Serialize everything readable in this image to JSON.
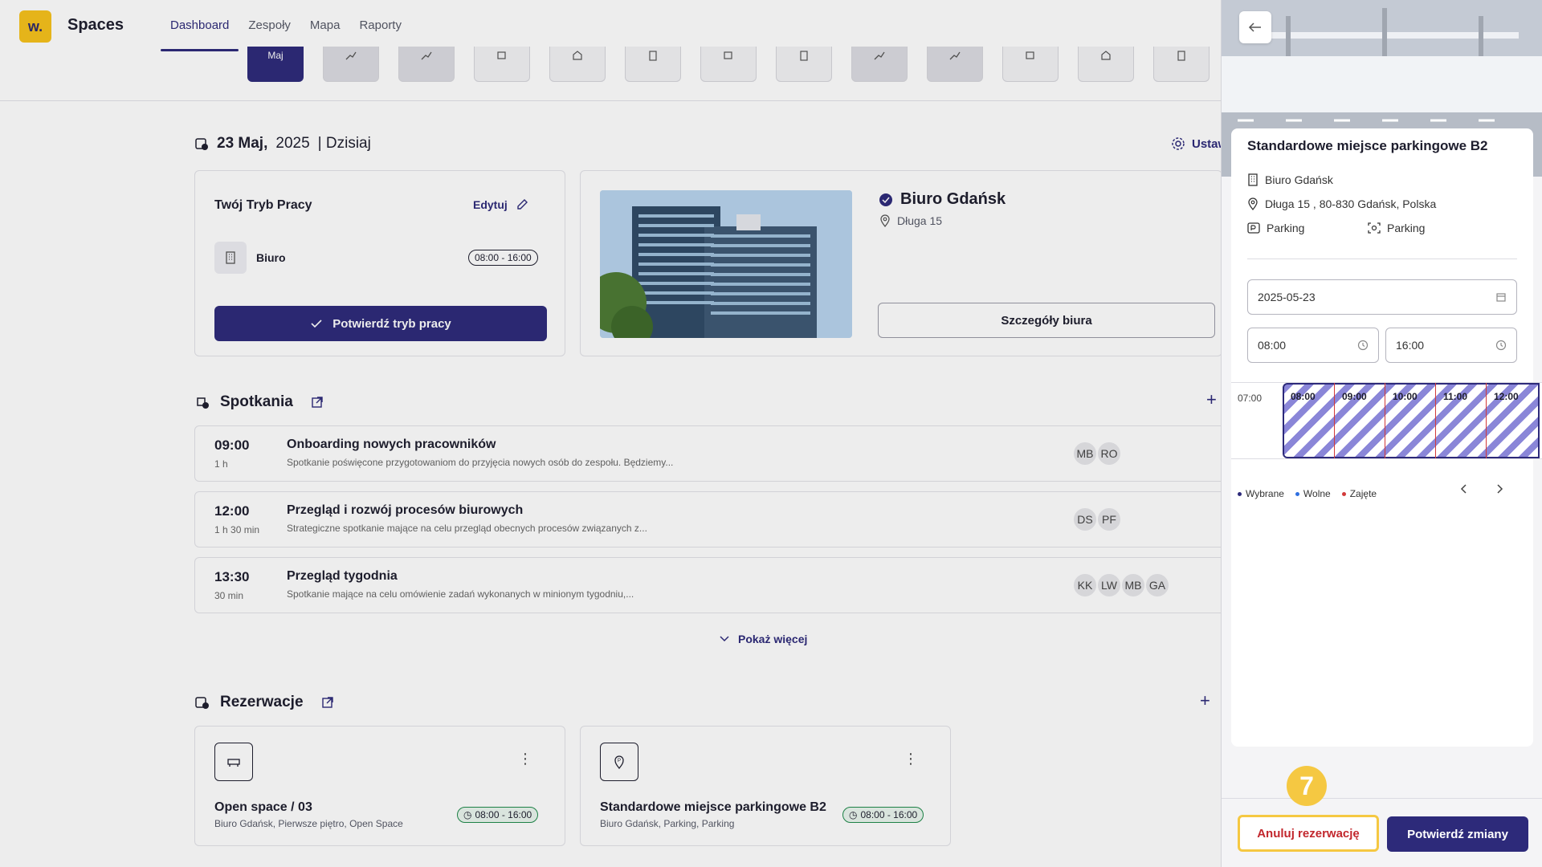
{
  "app": {
    "logo_text": "w.",
    "title": "Spaces"
  },
  "nav": {
    "items": [
      "Dashboard",
      "Zespoły",
      "Mapa",
      "Raporty"
    ],
    "active": "Dashboard"
  },
  "day_strip": {
    "selected_label": "Maj"
  },
  "date_header": {
    "day": "23 Maj,",
    "year": "2025",
    "today": "| Dzisiaj",
    "settings": "Ustaw"
  },
  "work_mode": {
    "title": "Twój Tryb Pracy",
    "edit": "Edytuj",
    "mode": "Biuro",
    "time": "08:00 - 16:00",
    "confirm": "Potwierdź tryb pracy"
  },
  "office": {
    "name": "Biuro Gdańsk",
    "address": "Długa 15",
    "details_button": "Szczegóły biura"
  },
  "meetings": {
    "title": "Spotkania",
    "show_more": "Pokaż więcej",
    "items": [
      {
        "time": "09:00",
        "duration": "1 h",
        "title": "Onboarding nowych pracowników",
        "desc": "Spotkanie poświęcone przygotowaniom do przyjęcia nowych osób do zespołu. Będziemy...",
        "avatars": [
          "MB",
          "RO"
        ]
      },
      {
        "time": "12:00",
        "duration": "1 h 30 min",
        "title": "Przegląd i rozwój procesów biurowych",
        "desc": "Strategiczne spotkanie mające na celu przegląd obecnych procesów związanych z...",
        "avatars": [
          "DS",
          "PF"
        ]
      },
      {
        "time": "13:30",
        "duration": "30 min",
        "title": "Przegląd tygodnia",
        "desc": "Spotkanie mające na celu omówienie zadań wykonanych w minionym tygodniu,...",
        "avatars": [
          "KK",
          "LW",
          "MB",
          "GA"
        ]
      }
    ]
  },
  "reservations": {
    "title": "Rezerwacje",
    "items": [
      {
        "title": "Open space / 03",
        "sub": "Biuro Gdańsk, Pierwsze piętro, Open Space",
        "time": "08:00 - 16:00"
      },
      {
        "title": "Standardowe miejsce parkingowe B2",
        "sub": "Biuro Gdańsk, Parking, Parking",
        "time": "08:00 - 16:00"
      }
    ]
  },
  "panel": {
    "title": "Standardowe miejsce parkingowe B2",
    "office": "Biuro Gdańsk",
    "address": "Długa 15 , 80-830 Gdańsk, Polska",
    "category": "Parking",
    "type": "Parking",
    "date": "2025-05-23",
    "time_from": "08:00",
    "time_to": "16:00",
    "timeline": {
      "start": "07:00",
      "hours": [
        "08:00",
        "09:00",
        "10:00",
        "11:00",
        "12:00"
      ]
    },
    "legend": {
      "selected": "Wybrane",
      "free": "Wolne",
      "taken": "Zajęte"
    },
    "cancel": "Anuluj rezerwację",
    "confirm": "Potwierdź zmiany",
    "step": "7"
  },
  "colors": {
    "primary": "#2d2a7a",
    "accent": "#f5c842",
    "danger": "#c2272d",
    "free": "#2f6fe0"
  }
}
